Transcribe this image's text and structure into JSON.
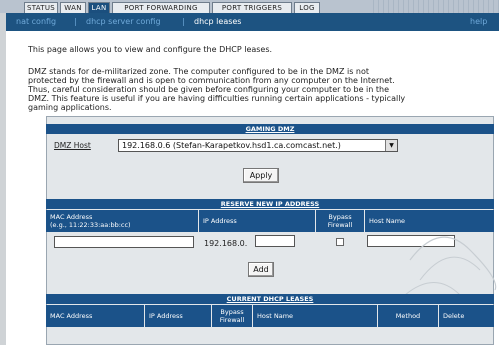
{
  "tabs": [
    {
      "label": "STATUS"
    },
    {
      "label": "WAN"
    },
    {
      "label": "LAN"
    },
    {
      "label": "PORT FORWARDING"
    },
    {
      "label": "PORT TRIGGERS"
    },
    {
      "label": "LOG"
    }
  ],
  "subnav": {
    "items": [
      "nat config",
      "dhcp server config",
      "dhcp leases"
    ],
    "separator": "|",
    "help": "help"
  },
  "intro": "This page allows you to view and configure the DHCP leases.",
  "dmz_desc": [
    "DMZ stands for de-militarized zone. The computer configured to be in the DMZ is not",
    "protected by the firewall and is open to communication from any computer on the Internet.",
    "Thus, careful consideration should be given before configuring your computer to be in the",
    "DMZ. This feature is useful if you are having difficulties running certain applications - typically",
    "gaming applications."
  ],
  "gaming_dmz": {
    "header": "GAMING DMZ",
    "host_label": "DMZ Host",
    "host_value": "192.168.0.6 (Stefan-Karapetkov.hsd1.ca.comcast.net.)",
    "apply_label": "Apply"
  },
  "reserve": {
    "header": "RESERVE NEW IP ADDRESS",
    "columns": [
      "MAC Address",
      "(e.g., 11:22:33:aa:bb:cc)",
      "IP Address",
      "Bypass",
      "Firewall",
      "Host Name"
    ],
    "ip_prefix": "192.168.0.",
    "add_label": "Add"
  },
  "leases": {
    "header": "CURRENT DHCP LEASES",
    "columns": [
      "MAC Address",
      "IP Address",
      "Bypass",
      "Firewall",
      "Host Name",
      "Method",
      "Delete"
    ]
  }
}
